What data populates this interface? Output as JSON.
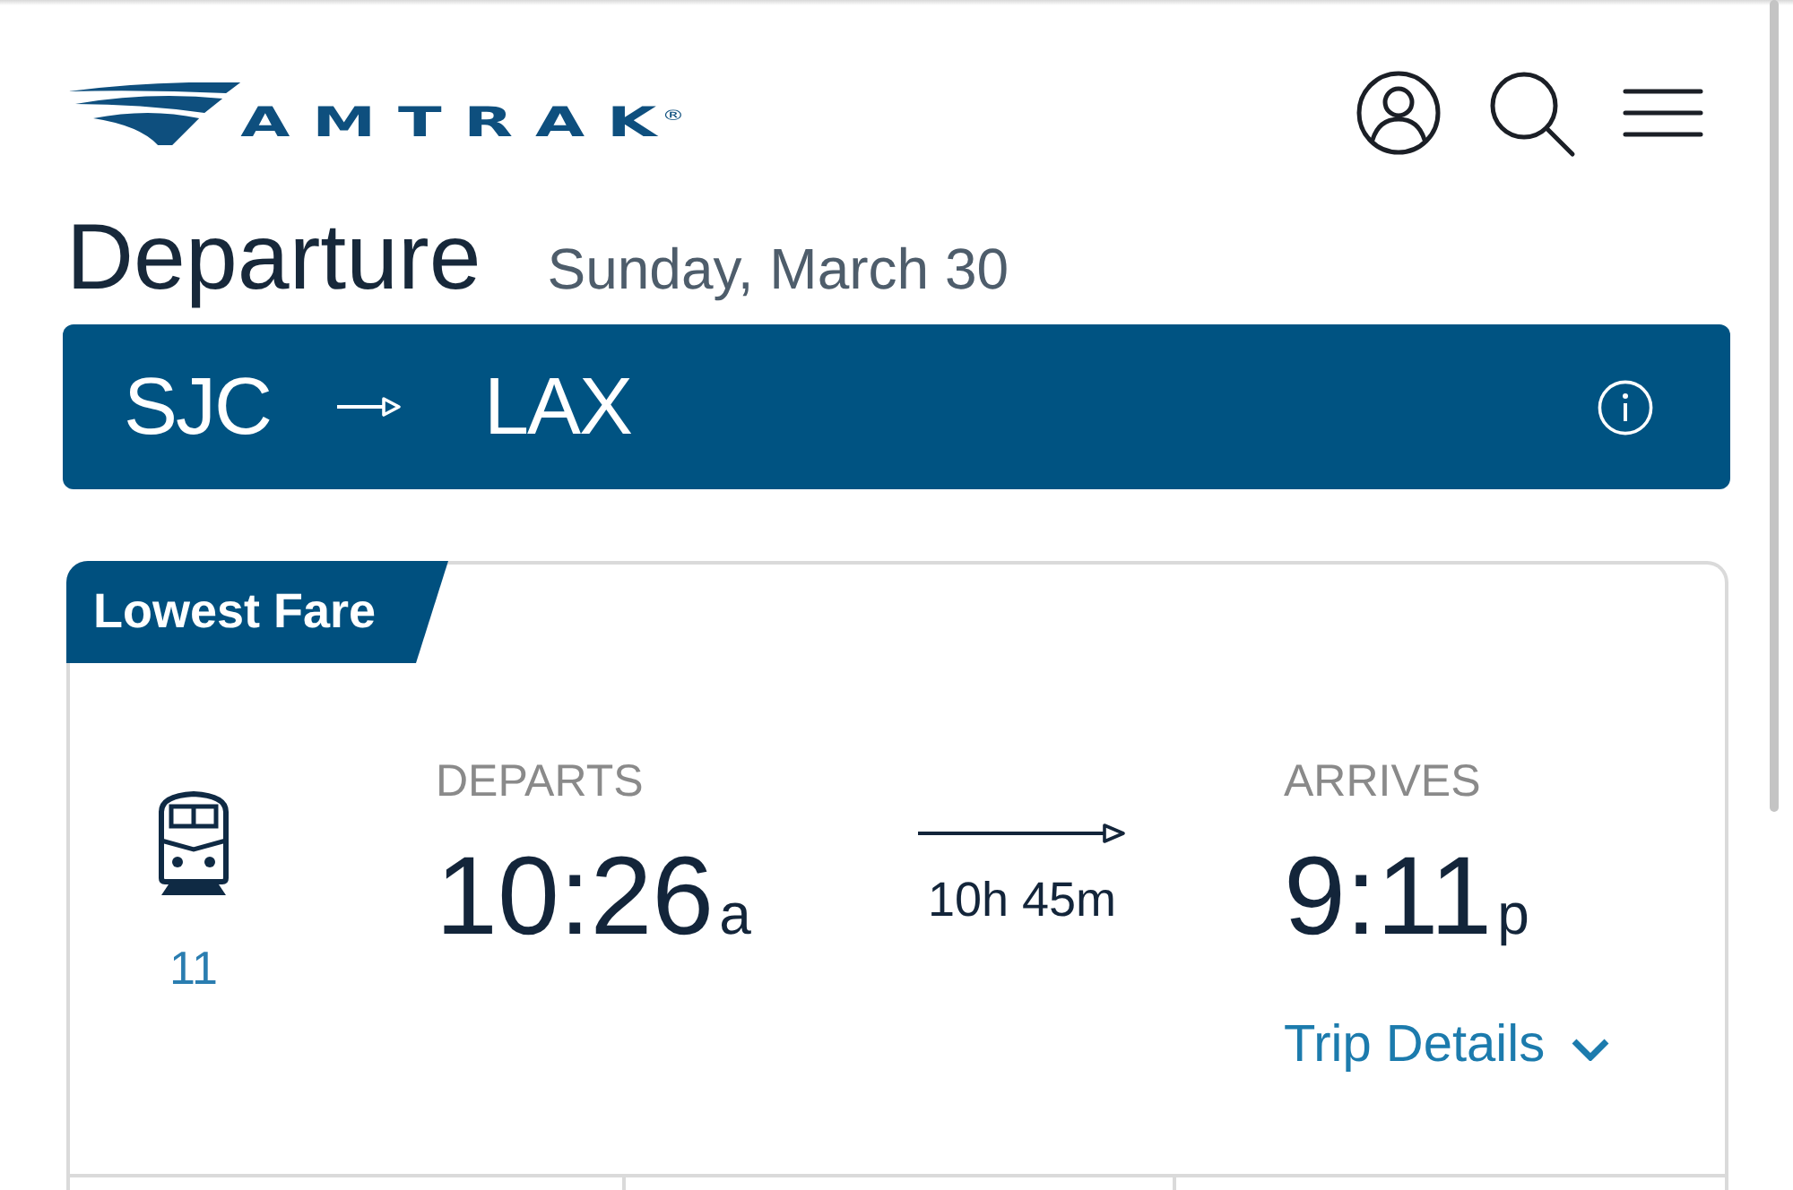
{
  "header": {
    "logo": "AMTRAK$^{®}$"
  },
  "page_title": "Departure",
  "date": "Sunday, March 30",
  "route": {
    "origin": "SJC",
    "destination": "LAX"
  },
  "fare_card": {
    "tag": "Lowest Fare",
    "train_number": "11",
    "departs": {
      "label": "DEPARTS",
      "time": "10:26",
      "meridiem": "a"
    },
    "duration": "10h 45m",
    "arrives": {
      "label": "ARRIVES",
      "time": "9:11",
      "meridiem": "p"
    },
    "trip_details": {
      "label": "Trip Details",
      "expanded": false
    }
  }
}
